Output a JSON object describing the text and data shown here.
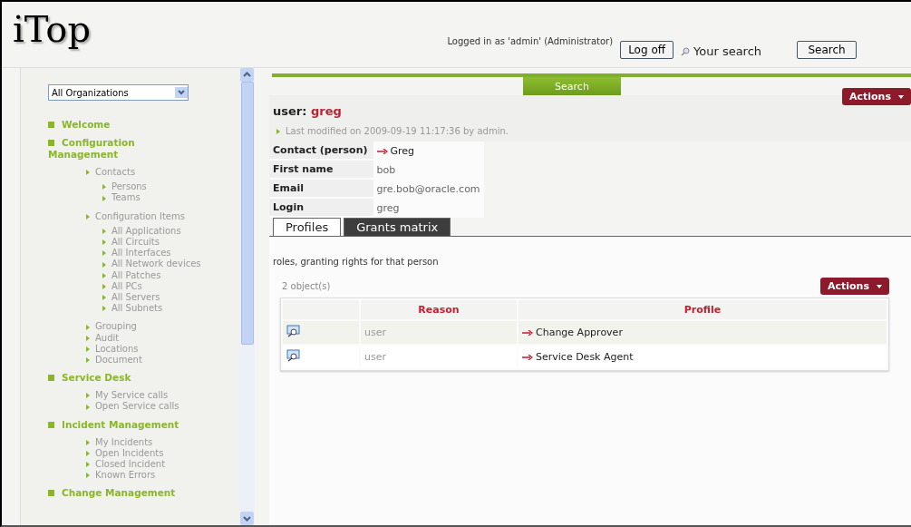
{
  "header": {
    "logo": "iTop",
    "login_text": "Logged in as 'admin' (Administrator)",
    "logoff_button": "Log off",
    "search": {
      "placeholder": "Your search"
    },
    "search_button": "Search"
  },
  "sidebar": {
    "org_select": "All Organizations",
    "menu": [
      {
        "label": "Welcome"
      },
      {
        "label": "Configuration Management",
        "children": [
          {
            "label": "Contacts",
            "children": [
              {
                "label": "Persons"
              },
              {
                "label": "Teams"
              }
            ]
          },
          {
            "label": "Configuration Items",
            "children": [
              {
                "label": "All Applications"
              },
              {
                "label": "All Circuits"
              },
              {
                "label": "All Interfaces"
              },
              {
                "label": "All Network devices"
              },
              {
                "label": "All Patches"
              },
              {
                "label": "All PCs"
              },
              {
                "label": "All Servers"
              },
              {
                "label": "All Subnets"
              }
            ]
          },
          {
            "label": "Grouping"
          },
          {
            "label": "Audit"
          },
          {
            "label": "Locations"
          },
          {
            "label": "Document"
          }
        ]
      },
      {
        "label": "Service Desk",
        "children": [
          {
            "label": "My Service calls"
          },
          {
            "label": "Open Service calls"
          }
        ]
      },
      {
        "label": "Incident Management",
        "children": [
          {
            "label": "My Incidents"
          },
          {
            "label": "Open Incidents"
          },
          {
            "label": "Closed Incident"
          },
          {
            "label": "Known Errors"
          }
        ]
      },
      {
        "label": "Change Management"
      }
    ]
  },
  "search_tab": "Search",
  "object": {
    "class_label": "user:",
    "name": "greg",
    "actions": "Actions",
    "last_modified": "Last modified on 2009-09-19 11:17:36 by admin.",
    "fields": [
      {
        "label": "Contact (person)",
        "value": "Greg",
        "kind": "link"
      },
      {
        "label": "First name",
        "value": "bob",
        "kind": "text"
      },
      {
        "label": "Email",
        "value": "gre.bob@oracle.com",
        "kind": "text"
      },
      {
        "label": "Login",
        "value": "greg",
        "kind": "text"
      }
    ]
  },
  "tabs": [
    {
      "label": "Profiles",
      "selected": true
    },
    {
      "label": "Grants matrix",
      "selected": false
    }
  ],
  "profiles": {
    "description": "roles, granting rights for that person",
    "count": "2 object(s)",
    "actions": "Actions",
    "columns": [
      "Reason",
      "Profile"
    ],
    "rows": [
      {
        "reason": "user",
        "profile": "Change Approver"
      },
      {
        "reason": "user",
        "profile": "Service Desk Agent"
      }
    ]
  }
}
